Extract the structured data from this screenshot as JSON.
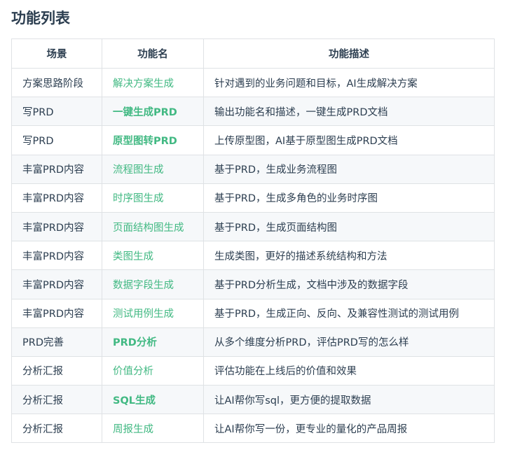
{
  "page_title": "功能列表",
  "accent_color": "#42b983",
  "table": {
    "headers": [
      "场景",
      "功能名",
      "功能描述"
    ],
    "rows": [
      {
        "scene": "方案思路阶段",
        "feature": "解决方案生成",
        "feature_bold": false,
        "description": "针对遇到的业务问题和目标，AI生成解决方案"
      },
      {
        "scene": "写PRD",
        "feature": "一键生成PRD",
        "feature_bold": true,
        "description": "输出功能名和描述，一键生成PRD文档"
      },
      {
        "scene": "写PRD",
        "feature": "原型图转PRD",
        "feature_bold": true,
        "description": "上传原型图，AI基于原型图生成PRD文档"
      },
      {
        "scene": "丰富PRD内容",
        "feature": "流程图生成",
        "feature_bold": false,
        "description": "基于PRD，生成业务流程图"
      },
      {
        "scene": "丰富PRD内容",
        "feature": "时序图生成",
        "feature_bold": false,
        "description": "基于PRD，生成多角色的业务时序图"
      },
      {
        "scene": "丰富PRD内容",
        "feature": "页面结构图生成",
        "feature_bold": false,
        "description": "基于PRD，生成页面结构图"
      },
      {
        "scene": "丰富PRD内容",
        "feature": "类图生成",
        "feature_bold": false,
        "description": "生成类图，更好的描述系统结构和方法"
      },
      {
        "scene": "丰富PRD内容",
        "feature": "数据字段生成",
        "feature_bold": false,
        "description": "基于PRD分析生成，文档中涉及的数据字段"
      },
      {
        "scene": "丰富PRD内容",
        "feature": "测试用例生成",
        "feature_bold": false,
        "description": "基于PRD，生成正向、反向、及兼容性测试的测试用例"
      },
      {
        "scene": "PRD完善",
        "feature": "PRD分析",
        "feature_bold": true,
        "description": "从多个维度分析PRD，评估PRD写的怎么样"
      },
      {
        "scene": "分析汇报",
        "feature": "价值分析",
        "feature_bold": false,
        "description": "评估功能在上线后的价值和效果"
      },
      {
        "scene": "分析汇报",
        "feature": "SQL生成",
        "feature_bold": true,
        "description": "让AI帮你写sql，更方便的提取数据"
      },
      {
        "scene": "分析汇报",
        "feature": "周报生成",
        "feature_bold": false,
        "description": "让AI帮你写一份，更专业的量化的产品周报"
      }
    ]
  }
}
